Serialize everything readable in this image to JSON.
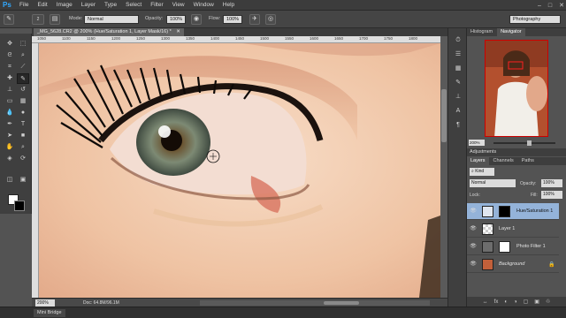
{
  "menubar": {
    "logo": "Ps",
    "items": [
      "File",
      "Edit",
      "Image",
      "Layer",
      "Type",
      "Select",
      "Filter",
      "View",
      "Window",
      "Help"
    ],
    "window_controls": [
      "–",
      "□",
      "✕"
    ]
  },
  "options": {
    "brush_size": "2",
    "mode_label": "Mode:",
    "mode_value": "Normal",
    "opacity_label": "Opacity:",
    "opacity_value": "100%",
    "flow_label": "Flow:",
    "flow_value": "100%",
    "workspace": "Photography"
  },
  "document": {
    "tab_title": "_MG_5628.CR2 @ 200% (Hue/Saturation 1, Layer Mask/16) *",
    "ruler_ticks": [
      "1050",
      "1100",
      "1150",
      "1200",
      "1250",
      "1300",
      "1350",
      "1400",
      "1450",
      "1500",
      "1550",
      "1600",
      "1650",
      "1700",
      "1750",
      "1800"
    ],
    "zoom": "200%",
    "doc_size": "Doc: 64.8M/96.1M"
  },
  "mini_bridge": "Mini Bridge",
  "navigator": {
    "tabs": [
      "Histogram",
      "Navigator"
    ],
    "zoom": "200%"
  },
  "adjustments": {
    "title": "Adjustments"
  },
  "layers_panel": {
    "tabs": [
      "Layers",
      "Channels",
      "Paths"
    ],
    "kind": "⌕ Kind",
    "blend": "Normal",
    "opacity_label": "Opacity:",
    "opacity_value": "100%",
    "lock_label": "Lock:",
    "fill_label": "Fill:",
    "fill_value": "100%",
    "layers": [
      {
        "name": "Hue/Saturation 1"
      },
      {
        "name": "Layer 1"
      },
      {
        "name": "Photo Filter 1"
      },
      {
        "name": "Background"
      }
    ],
    "footer_icons": [
      "↔",
      "fx",
      "◐",
      "◑",
      "▢",
      "▣",
      "♲"
    ]
  },
  "colors": {
    "selected_layer": "#94b3d9",
    "foreground": "#ffffff",
    "background": "#000000",
    "ps_blue": "#31a8ff"
  }
}
